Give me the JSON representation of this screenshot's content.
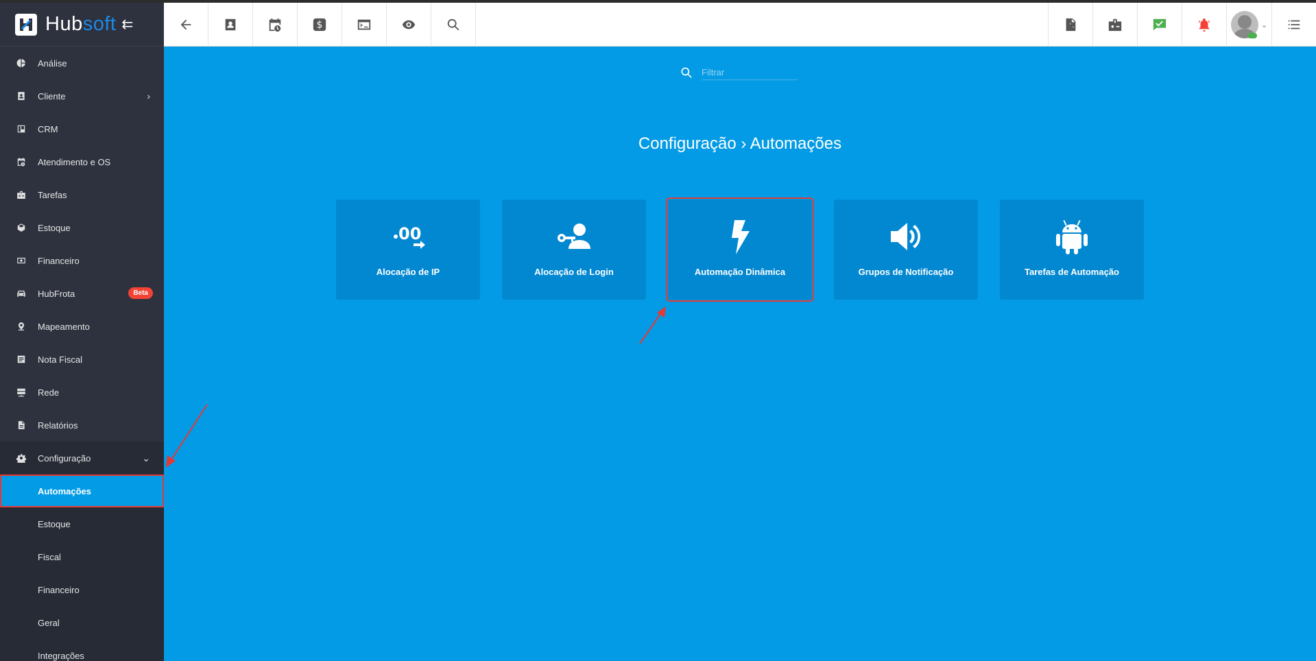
{
  "app": {
    "brand_part1": "Hub",
    "brand_part2": "soft"
  },
  "sidebar": {
    "items": [
      {
        "label": "Análise",
        "icon": "pie-chart-icon"
      },
      {
        "label": "Cliente",
        "icon": "contact-icon"
      },
      {
        "label": "CRM",
        "icon": "board-icon"
      },
      {
        "label": "Atendimento e OS",
        "icon": "calendar-clock-icon"
      },
      {
        "label": "Tarefas",
        "icon": "badge-icon"
      },
      {
        "label": "Estoque",
        "icon": "box-icon"
      },
      {
        "label": "Financeiro",
        "icon": "money-icon"
      },
      {
        "label": "HubFrota",
        "icon": "car-icon",
        "badge": "Beta"
      },
      {
        "label": "Mapeamento",
        "icon": "map-pin-icon"
      },
      {
        "label": "Nota Fiscal",
        "icon": "document-icon"
      },
      {
        "label": "Rede",
        "icon": "server-icon"
      },
      {
        "label": "Relatórios",
        "icon": "report-icon"
      },
      {
        "label": "Configuração",
        "icon": "gear-icon"
      }
    ],
    "submenu": [
      {
        "label": "Automações"
      },
      {
        "label": "Estoque"
      },
      {
        "label": "Fiscal"
      },
      {
        "label": "Financeiro"
      },
      {
        "label": "Geral"
      },
      {
        "label": "Integrações"
      }
    ]
  },
  "search": {
    "placeholder": "Filtrar"
  },
  "page": {
    "title": "Configuração › Automações"
  },
  "cards": [
    {
      "label": "Alocação de IP",
      "icon": "ip-allocation-icon"
    },
    {
      "label": "Alocação de Login",
      "icon": "key-user-icon"
    },
    {
      "label": "Automação Dinâmica",
      "icon": "lightning-icon"
    },
    {
      "label": "Grupos de Notificação",
      "icon": "speaker-icon"
    },
    {
      "label": "Tarefas de Automação",
      "icon": "android-icon"
    }
  ],
  "colors": {
    "primary": "#039be5",
    "sidebar": "#2d323e",
    "highlight": "#e53935",
    "notif_green": "#4caf50",
    "alert_red": "#f44336"
  }
}
